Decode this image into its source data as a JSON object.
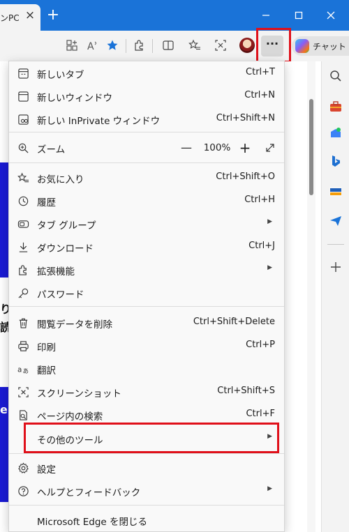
{
  "browser": {
    "tab_title": "ンPC",
    "tab_close_glyph": "×",
    "new_tab_glyph": "+",
    "more_glyph": "···",
    "chat_label": "チャット",
    "window_buttons": [
      "minimize-icon",
      "maximize-icon",
      "close-icon"
    ],
    "accent_color": "#1a73d8",
    "highlight_color": "#e0101a"
  },
  "menu": {
    "items": [
      {
        "label": "新しいタブ",
        "shortcut": "Ctrl+T",
        "icon": "new-tab-icon"
      },
      {
        "label": "新しいウィンドウ",
        "shortcut": "Ctrl+N",
        "icon": "new-window-icon"
      },
      {
        "label": "新しい InPrivate ウィンドウ",
        "shortcut": "Ctrl+Shift+N",
        "icon": "inprivate-icon"
      },
      {
        "label": "ズーム",
        "icon": "zoom-icon"
      },
      {
        "label": "お気に入り",
        "shortcut": "Ctrl+Shift+O",
        "icon": "favorites-icon"
      },
      {
        "label": "履歴",
        "shortcut": "Ctrl+H",
        "icon": "history-icon"
      },
      {
        "label": "タブ グループ",
        "icon": "tab-group-icon"
      },
      {
        "label": "ダウンロード",
        "shortcut": "Ctrl+J",
        "icon": "download-icon"
      },
      {
        "label": "拡張機能",
        "icon": "extensions-icon"
      },
      {
        "label": "パスワード",
        "icon": "key-icon"
      },
      {
        "label": "閲覧データを削除",
        "shortcut": "Ctrl+Shift+Delete",
        "icon": "trash-icon"
      },
      {
        "label": "印刷",
        "shortcut": "Ctrl+P",
        "icon": "printer-icon"
      },
      {
        "label": "翻訳",
        "icon": "translate-icon"
      },
      {
        "label": "スクリーンショット",
        "shortcut": "Ctrl+Shift+S",
        "icon": "screenshot-icon"
      },
      {
        "label": "ページ内の検索",
        "shortcut": "Ctrl+F",
        "icon": "find-in-page-icon"
      },
      {
        "label": "その他のツール",
        "icon": ""
      },
      {
        "label": "設定",
        "icon": "settings-icon"
      },
      {
        "label": "ヘルプとフィードバック",
        "icon": "help-icon"
      },
      {
        "label": "Microsoft Edge を閉じる",
        "icon": ""
      }
    ],
    "zoom": {
      "minus": "—",
      "value": "100%",
      "plus": "+"
    },
    "submenu_arrow": "▶"
  },
  "page": {
    "fragments": [
      "り",
      "読",
      "e"
    ]
  }
}
